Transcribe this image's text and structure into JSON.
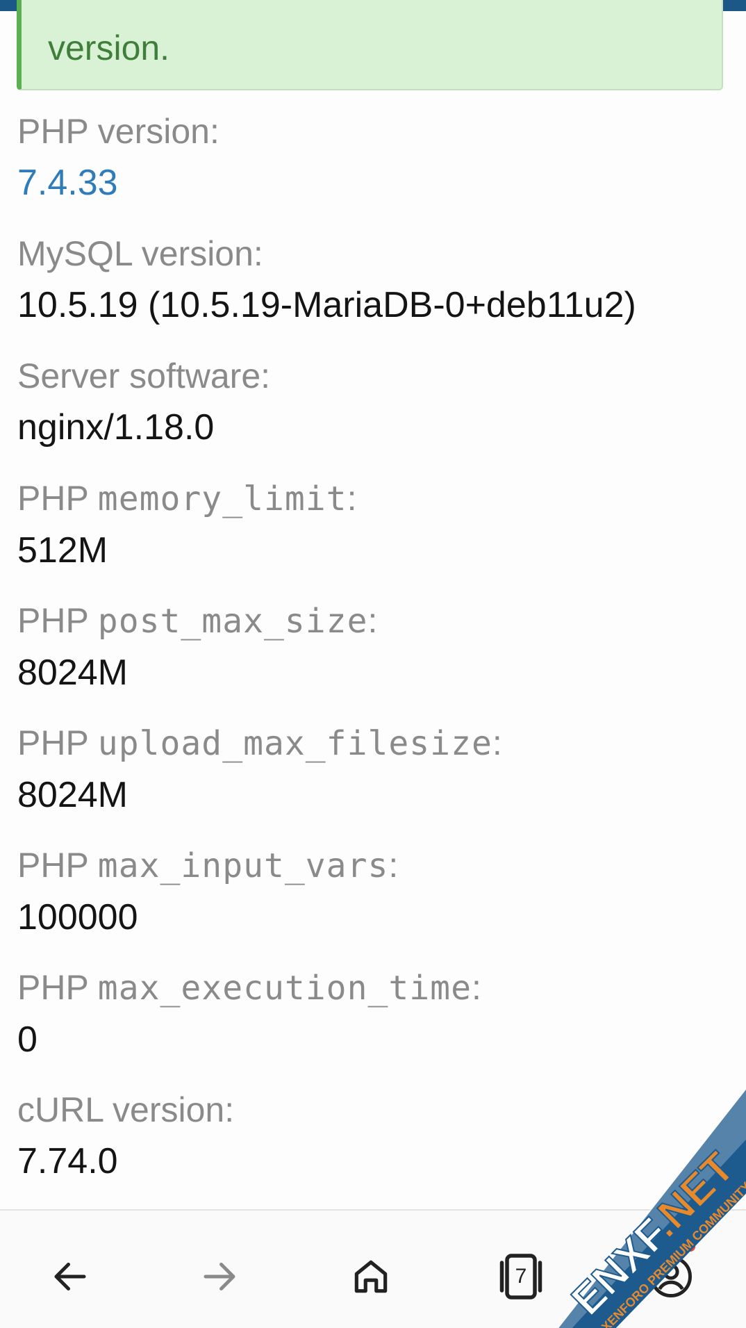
{
  "notice": {
    "text": "version."
  },
  "info": [
    {
      "label": "PHP version:",
      "value": "7.4.33",
      "link": true
    },
    {
      "label": "MySQL version:",
      "value": "10.5.19 (10.5.19-MariaDB-0+deb11u2)"
    },
    {
      "label": "Server software:",
      "value": "nginx/1.18.0"
    },
    {
      "label_prefix": "PHP ",
      "label_code": "memory_limit",
      "label_suffix": ":",
      "value": "512M"
    },
    {
      "label_prefix": "PHP ",
      "label_code": "post_max_size",
      "label_suffix": ":",
      "value": "8024M"
    },
    {
      "label_prefix": "PHP ",
      "label_code": "upload_max_filesize",
      "label_suffix": ":",
      "value": "8024M"
    },
    {
      "label_prefix": "PHP ",
      "label_code": "max_input_vars",
      "label_suffix": ":",
      "value": "100000"
    },
    {
      "label_prefix": "PHP ",
      "label_code": "max_execution_time",
      "label_suffix": ":",
      "value": "0"
    },
    {
      "label": "cURL version:",
      "value": "7.74.0"
    }
  ],
  "bottom_nav": {
    "back_icon": "arrow-left-icon",
    "forward_icon": "arrow-right-icon",
    "home_icon": "home-icon",
    "tabs_icon": "tabs-icon",
    "tab_count": "7",
    "account_icon": "account-circle-icon"
  },
  "watermark": {
    "brand": "ENXF.NET",
    "tagline": "XENFORO PREMIUM COMMUNITY"
  },
  "colors": {
    "top_bar": "#1b5787",
    "notice_bg": "#d9f2d5",
    "notice_accent": "#5bb051",
    "notice_text": "#3f7f3a",
    "label": "#8a8a8a",
    "value": "#141414",
    "link": "#2f7cb8",
    "notification_dot": "#e8453c"
  }
}
